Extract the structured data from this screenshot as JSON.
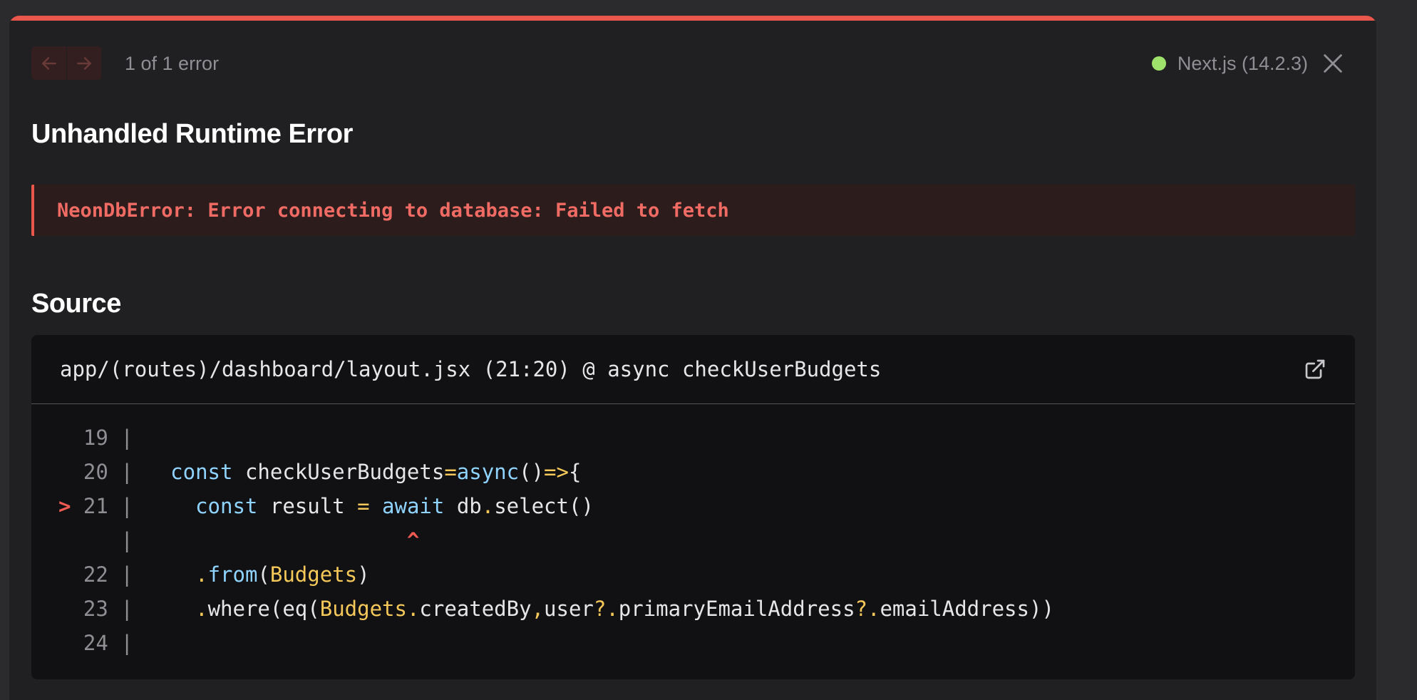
{
  "header": {
    "error_count": "1 of 1 error",
    "version": "Next.js (14.2.3)",
    "colors": {
      "accent": "#e9564c",
      "status_ok": "#9ee16b"
    }
  },
  "title": "Unhandled Runtime Error",
  "error_message": "NeonDbError: Error connecting to database: Failed to fetch",
  "source": {
    "heading": "Source",
    "file_path": "app/(routes)/dashboard/layout.jsx (21:20) @ async checkUserBudgets",
    "lines": [
      {
        "marker": " ",
        "num": "19",
        "code": ""
      },
      {
        "marker": " ",
        "num": "20",
        "code": "const checkUserBudgets=async()=>{"
      },
      {
        "marker": ">",
        "num": "21",
        "code": "  const result = await db.select()"
      },
      {
        "marker": " ",
        "num": "",
        "code": "                   ^"
      },
      {
        "marker": " ",
        "num": "22",
        "code": "  .from(Budgets)"
      },
      {
        "marker": " ",
        "num": "23",
        "code": "  .where(eq(Budgets.createdBy,user?.primaryEmailAddress?.emailAddress))"
      },
      {
        "marker": " ",
        "num": "24",
        "code": ""
      }
    ]
  },
  "icons": {
    "prev": "arrow-left-icon",
    "next": "arrow-right-icon",
    "close": "close-icon",
    "open_in_editor": "external-link-icon"
  }
}
